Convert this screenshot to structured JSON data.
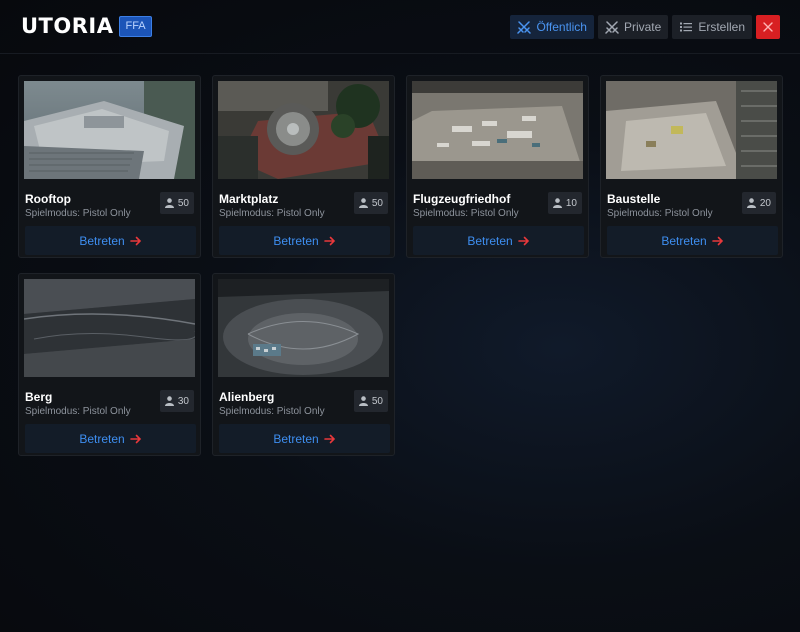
{
  "header": {
    "title": "UTORIA",
    "badge": "FFA",
    "tabs": [
      {
        "label": "Öffentlich",
        "icon": "swords-icon",
        "active": true
      },
      {
        "label": "Private",
        "icon": "swords-icon",
        "active": false
      },
      {
        "label": "Erstellen",
        "icon": "list-icon",
        "active": false
      }
    ]
  },
  "lobbies": [
    {
      "name": "Rooftop",
      "mode": "Spielmodus: Pistol Only",
      "players": "50",
      "join_label": "Betreten"
    },
    {
      "name": "Marktplatz",
      "mode": "Spielmodus: Pistol Only",
      "players": "50",
      "join_label": "Betreten"
    },
    {
      "name": "Flugzeugfriedhof",
      "mode": "Spielmodus: Pistol Only",
      "players": "10",
      "join_label": "Betreten"
    },
    {
      "name": "Baustelle",
      "mode": "Spielmodus: Pistol Only",
      "players": "20",
      "join_label": "Betreten"
    },
    {
      "name": "Berg",
      "mode": "Spielmodus: Pistol Only",
      "players": "30",
      "join_label": "Betreten"
    },
    {
      "name": "Alienberg",
      "mode": "Spielmodus: Pistol Only",
      "players": "50",
      "join_label": "Betreten"
    }
  ],
  "colors": {
    "accent": "#3e8ef0",
    "close": "#d81f22",
    "arrow": "#e8383b"
  }
}
